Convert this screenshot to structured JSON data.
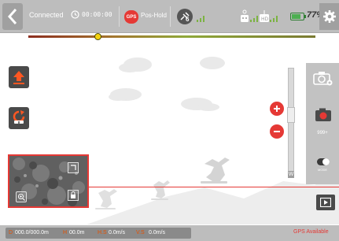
{
  "topbar": {
    "back_icon": "chevron-left-icon",
    "connection_status": "Connected",
    "flight_time": "00:00:00",
    "gps_badge": "GPS",
    "flight_mode": "Pos-Hold",
    "satellite_count": "6",
    "satellite_icon": "satellite-icon",
    "controller_icon": "remote-controller-icon",
    "camera_signal_icon": "video-link-icon",
    "battery_level": 77,
    "battery_text": "77%",
    "settings_icon": "gear-icon"
  },
  "flight_progress": {
    "fraction": 0.24
  },
  "actions": {
    "takeoff_icon": "takeoff-icon",
    "return_home_icon": "return-home-icon"
  },
  "zoom": {
    "top_label": "T",
    "bottom_label": "W",
    "zoom_in_icon": "plus-icon",
    "zoom_out_icon": "minus-icon",
    "level": 0.6
  },
  "camera_panel": {
    "switch_camera_icon": "camera-switch-icon",
    "record_icon": "record-icon",
    "remaining_count": "999+",
    "mode_label": "MODE",
    "mode_toggle_on": true,
    "playback_icon": "playback-icon"
  },
  "minimap": {
    "expand_icon": "map-expand-icon",
    "locate_icon": "zoom-target-icon",
    "lock_icon": "lock-icon"
  },
  "telemetry": {
    "distance_label": "D",
    "distance_value": "000.0/000.0m",
    "height_label": "H",
    "height_value": "00.0m",
    "hspeed_label": "H.S",
    "hspeed_value": "0.0m/s",
    "vspeed_label": "V.S",
    "vspeed_value": "0.0m/s"
  },
  "gps_status": "GPS Available",
  "colors": {
    "accent_red": "#e53935",
    "battery_green": "#4caf50",
    "label_orange": "#e65100"
  }
}
